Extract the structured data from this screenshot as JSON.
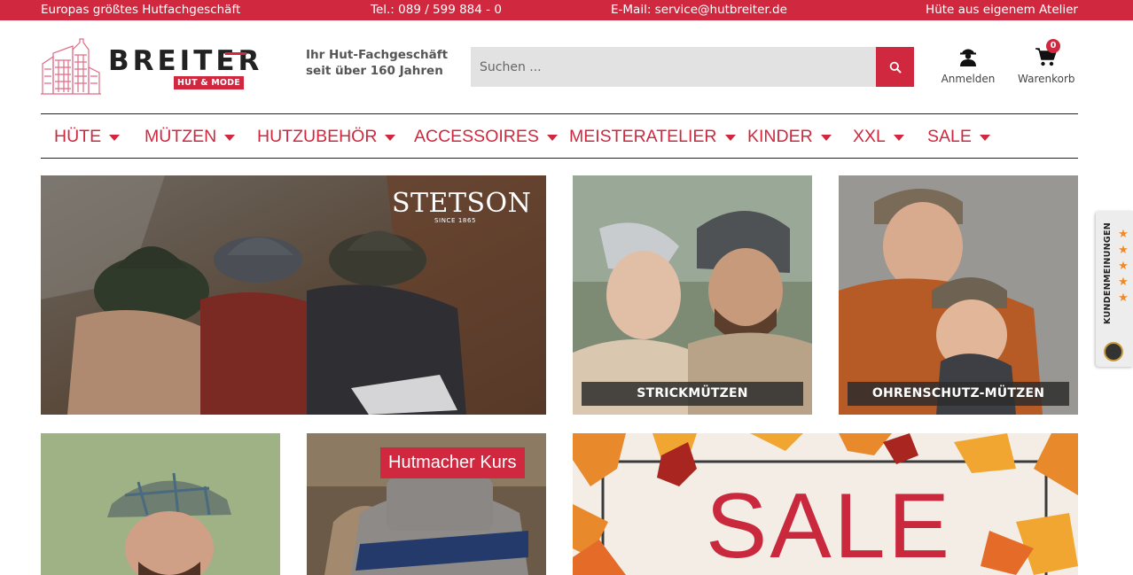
{
  "topbar": {
    "slogan": "Europas größtes Hutfachgeschäft",
    "phone": "Tel.: 089 / 599 884 - 0",
    "email": "E-Mail: service@hutbreiter.de",
    "atelier": "Hüte aus eigenem Atelier"
  },
  "brand": {
    "name": "BREITER",
    "badge": "HUT & MODE",
    "tagline_line1": "Ihr Hut-Fachgeschäft",
    "tagline_line2": "seit über 160 Jahren"
  },
  "search": {
    "placeholder": "Suchen ...",
    "button_icon": "search-icon"
  },
  "account": {
    "label": "Anmelden",
    "icon": "user-icon"
  },
  "cart": {
    "label": "Warenkorb",
    "count": "0",
    "icon": "cart-icon"
  },
  "nav": {
    "items": [
      {
        "label": "HÜTE"
      },
      {
        "label": "MÜTZEN"
      },
      {
        "label": "HUTZUBEHÖR"
      },
      {
        "label": "ACCESSOIRES"
      },
      {
        "label": "MEISTERATELIER"
      },
      {
        "label": "KINDER"
      },
      {
        "label": "XXL"
      },
      {
        "label": "SALE"
      }
    ]
  },
  "tiles": {
    "stetson": {
      "brand": "STETSON",
      "since": "SINCE 1865"
    },
    "strickmuetzen": {
      "label": "STRICKMÜTZEN"
    },
    "ohrenschutz": {
      "label": "OHRENSCHUTZ-MÜTZEN"
    },
    "hutmacher": {
      "label": "Hutmacher Kurs"
    },
    "sale": {
      "label": "SALE"
    }
  },
  "review_widget": {
    "label": "KUNDENMEINUNGEN",
    "stars": "★★★★★"
  },
  "colors": {
    "brand_red": "#d0283f",
    "sale_red": "#c9283d",
    "search_bg": "#e2e2e2",
    "star_orange": "#f08a24"
  }
}
